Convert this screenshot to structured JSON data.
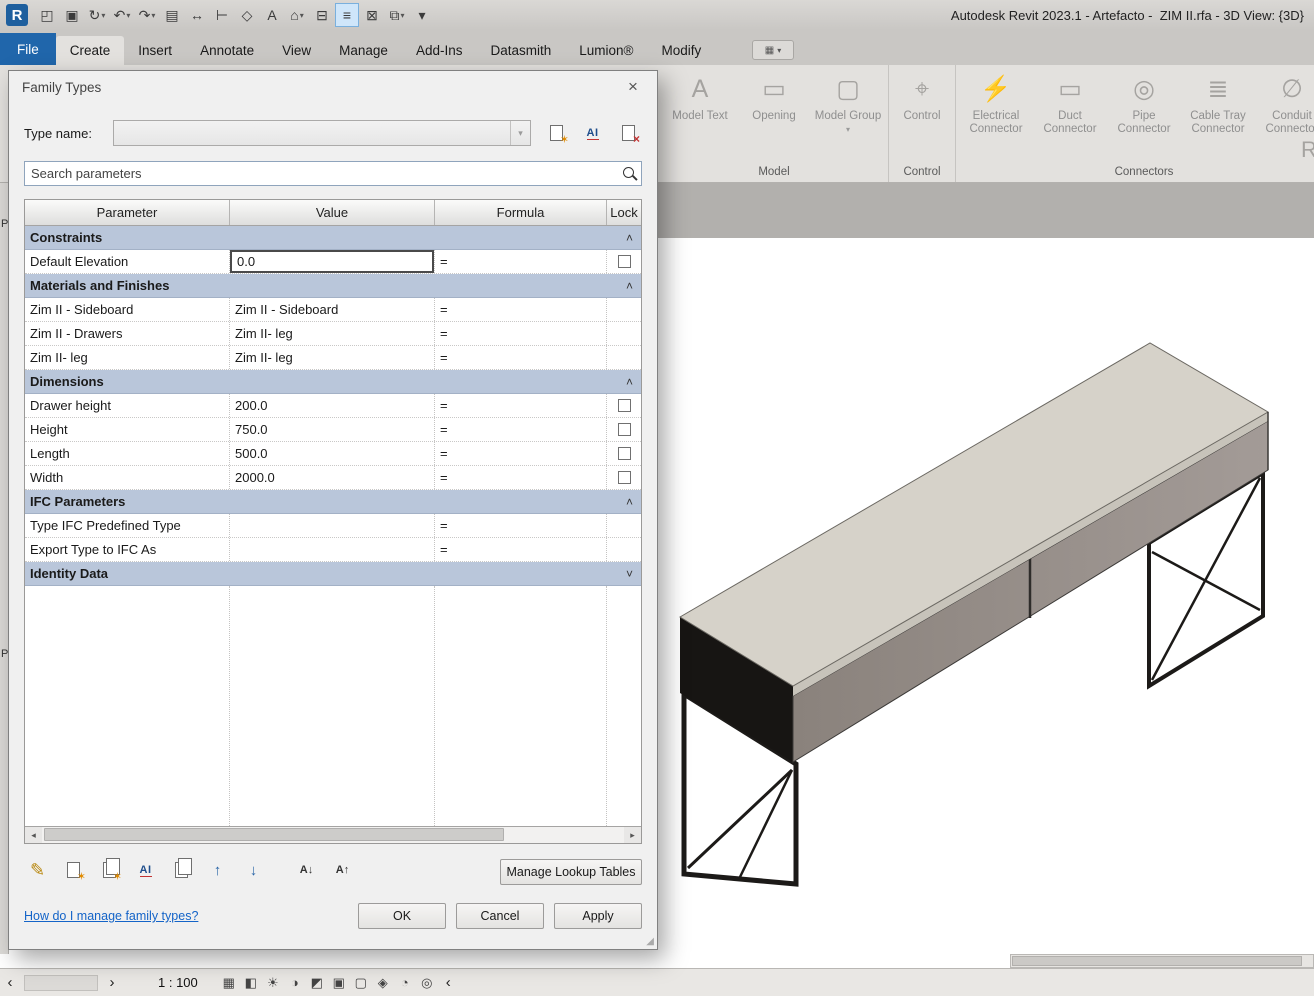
{
  "titlebar": {
    "title": "Autodesk Revit 2023.1 - Artefacto -  ZIM II.rfa - 3D View: {3D}",
    "quick_access": [
      {
        "name": "revit-logo",
        "glyph": "R",
        "logo": true
      },
      {
        "name": "open-file-icon",
        "glyph": "◰"
      },
      {
        "name": "save-icon",
        "glyph": "▣"
      },
      {
        "name": "sync-with-central-icon",
        "glyph": "↻",
        "dropdown": true
      },
      {
        "name": "undo-icon",
        "glyph": "↶",
        "dropdown": true
      },
      {
        "name": "redo-icon",
        "glyph": "↷",
        "dropdown": true
      },
      {
        "name": "print-icon",
        "glyph": "▤"
      },
      {
        "name": "measure-icon",
        "glyph": "↔"
      },
      {
        "name": "aligned-dimension-icon",
        "glyph": "⊢"
      },
      {
        "name": "tag-by-category-icon",
        "glyph": "◇"
      },
      {
        "name": "text-icon",
        "glyph": "A"
      },
      {
        "name": "default-3d-view-icon",
        "glyph": "⌂",
        "dropdown": true
      },
      {
        "name": "section-icon",
        "glyph": "⊟"
      },
      {
        "name": "thin-lines-icon",
        "glyph": "≡",
        "highlight": true
      },
      {
        "name": "close-hidden-windows-icon",
        "glyph": "⊠"
      },
      {
        "name": "switch-windows-icon",
        "glyph": "⧉",
        "dropdown": true
      },
      {
        "name": "customize-quick-access-icon",
        "glyph": "▾"
      }
    ]
  },
  "ribbon": {
    "tabs": [
      {
        "label": "File",
        "file": true
      },
      {
        "label": "Create",
        "active": true
      },
      {
        "label": "Insert"
      },
      {
        "label": "Annotate"
      },
      {
        "label": "View"
      },
      {
        "label": "Manage"
      },
      {
        "label": "Add-Ins"
      },
      {
        "label": "Datasmith"
      },
      {
        "label": "Lumion®"
      },
      {
        "label": "Modify"
      }
    ],
    "panel_toggle_icon": "▦",
    "panel_toggle_glyph": "▾",
    "panels": [
      {
        "label": "Model",
        "buttons": [
          {
            "label": "Model Text",
            "icon": "model-text-icon",
            "glyph": "A"
          },
          {
            "label": "Opening",
            "icon": "opening-icon",
            "glyph": "▭"
          },
          {
            "label": "Model Group",
            "icon": "model-group-icon",
            "glyph": "▢",
            "dropdown": true
          }
        ]
      },
      {
        "label": "Control",
        "buttons": [
          {
            "label": "Control",
            "icon": "control-icon",
            "glyph": "⌖",
            "narrow": true
          }
        ]
      },
      {
        "label": "Connectors",
        "buttons": [
          {
            "label": "Electrical Connector",
            "icon": "electrical-connector-icon",
            "glyph": "⚡"
          },
          {
            "label": "Duct Connector",
            "icon": "duct-connector-icon",
            "glyph": "▭"
          },
          {
            "label": "Pipe Connector",
            "icon": "pipe-connector-icon",
            "glyph": "◎"
          },
          {
            "label": "Cable Tray Connector",
            "icon": "cable-tray-connector-icon",
            "glyph": "≣"
          },
          {
            "label": "Conduit Connector",
            "icon": "conduit-connector-icon",
            "glyph": "∅"
          }
        ]
      }
    ],
    "clipped_button_label": "R"
  },
  "dialog": {
    "title": "Family Types",
    "close_glyph": "×",
    "type_name_label": "Type name:",
    "type_name_value": "",
    "combo_arrow_glyph": "▾",
    "type_name_icons": [
      {
        "name": "new-type-icon",
        "type": "page-star"
      },
      {
        "name": "rename-type-icon",
        "type": "rename",
        "text": "AI"
      },
      {
        "name": "delete-type-icon",
        "type": "page-delete"
      }
    ],
    "search": {
      "placeholder": "Search parameters"
    },
    "table": {
      "columns": [
        "Parameter",
        "Value",
        "Formula",
        "Lock"
      ],
      "sections": [
        {
          "name": "Constraints",
          "collapsed": false,
          "rows": [
            {
              "parameter": "Default Elevation",
              "value": "0.0",
              "formula": "=",
              "lock": true,
              "editing": true
            }
          ]
        },
        {
          "name": "Materials and Finishes",
          "collapsed": false,
          "rows": [
            {
              "parameter": "Zim II - Sideboard",
              "value": "Zim II - Sideboard",
              "formula": "=",
              "lock": false
            },
            {
              "parameter": "Zim II - Drawers",
              "value": "Zim II- leg",
              "formula": "=",
              "lock": false
            },
            {
              "parameter": "Zim II- leg",
              "value": "Zim II- leg",
              "formula": "=",
              "lock": false
            }
          ]
        },
        {
          "name": "Dimensions",
          "collapsed": false,
          "rows": [
            {
              "parameter": "Drawer height",
              "value": "200.0",
              "formula": "=",
              "lock": true
            },
            {
              "parameter": "Height",
              "value": "750.0",
              "formula": "=",
              "lock": true
            },
            {
              "parameter": "Length",
              "value": "500.0",
              "formula": "=",
              "lock": true
            },
            {
              "parameter": "Width",
              "value": "2000.0",
              "formula": "=",
              "lock": true
            }
          ]
        },
        {
          "name": "IFC Parameters",
          "collapsed": false,
          "rows": [
            {
              "parameter": "Type IFC Predefined Type",
              "value": "",
              "formula": "=",
              "lock": false
            },
            {
              "parameter": "Export Type to IFC As",
              "value": "",
              "formula": "=",
              "lock": false
            }
          ]
        },
        {
          "name": "Identity Data",
          "collapsed": true,
          "rows": []
        }
      ]
    },
    "toolbar": [
      {
        "name": "edit-parameter-icon",
        "type": "pencil",
        "glyph": "✎"
      },
      {
        "name": "new-parameter-icon",
        "type": "page-star"
      },
      {
        "name": "duplicate-parameter-icon",
        "type": "pages-star"
      },
      {
        "name": "rename-parameter-icon",
        "type": "rename",
        "text": "AI"
      },
      {
        "name": "copy-parameter-icon",
        "type": "pages"
      },
      {
        "name": "move-parameter-up-icon",
        "type": "move",
        "glyph": "↑"
      },
      {
        "name": "move-parameter-down-icon",
        "type": "move",
        "glyph": "↓"
      },
      {
        "name": "sort-ascending-icon",
        "type": "sort",
        "glyph": "A↓",
        "gap": true
      },
      {
        "name": "sort-descending-icon",
        "type": "sort",
        "glyph": "A↑"
      }
    ],
    "scrollbar": {
      "left": "◂",
      "right": "▸"
    },
    "footer": {
      "manage_lookup_tables": "Manage Lookup Tables",
      "help_link": "How do I manage family types?",
      "ok": "OK",
      "cancel": "Cancel",
      "apply": "Apply"
    },
    "resize_glyph": "◢"
  },
  "canvas": {
    "model": {
      "top_color": "#d6d2c9",
      "edge_color": "#c7c3ba",
      "front_color_left": "#8a827c",
      "front_color_right": "#a39b97",
      "side_color": "#171513",
      "line_color": "#1c1a18"
    }
  },
  "statusbar": {
    "nav_back": "‹",
    "nav_forward": "›",
    "scale": "1 : 100",
    "expand": "‹",
    "view_icons": [
      {
        "name": "detail-level-icon",
        "glyph": "▦"
      },
      {
        "name": "visual-style-icon",
        "glyph": "◧"
      },
      {
        "name": "sun-path-icon",
        "glyph": "☀"
      },
      {
        "name": "shadows-icon",
        "glyph": "◑"
      },
      {
        "name": "render-icon",
        "glyph": "◩"
      },
      {
        "name": "crop-view-icon",
        "glyph": "▣"
      },
      {
        "name": "crop-region-icon",
        "glyph": "▢"
      },
      {
        "name": "locked-view-icon",
        "glyph": "◈"
      },
      {
        "name": "hide-isolate-icon",
        "glyph": "◔"
      },
      {
        "name": "reveal-hidden-icon",
        "glyph": "◎"
      }
    ]
  },
  "edge_labels": [
    "P",
    "P"
  ]
}
